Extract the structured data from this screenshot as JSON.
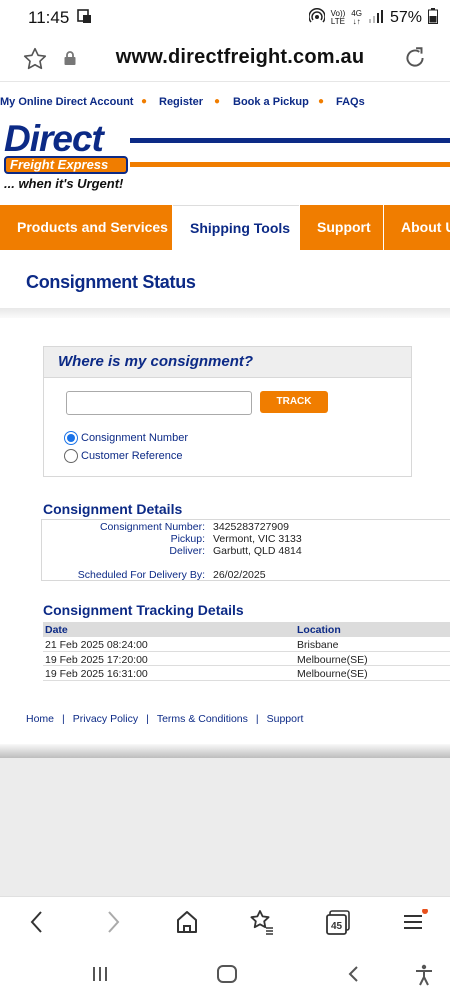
{
  "status_bar": {
    "time": "11:45",
    "volte_top": "Vo))",
    "volte_bottom": "LTE",
    "network": "4G",
    "battery": "57%"
  },
  "browser": {
    "url": "www.directfreight.com.au",
    "tab_count": "45"
  },
  "top_links": [
    "My Online Direct Account",
    "Register",
    "Book a Pickup",
    "FAQs"
  ],
  "logo": {
    "name": "Direct",
    "subtitle": "Freight Express",
    "tagline": "... when it's Urgent!"
  },
  "nav_tabs": [
    "Products and Services",
    "Shipping Tools",
    "Support",
    "About Us"
  ],
  "page_title": "Consignment Status",
  "tracker": {
    "heading": "Where is my consignment?",
    "input_value": "",
    "button_label": "TRACK",
    "options": [
      {
        "label": "Consignment Number",
        "selected": true
      },
      {
        "label": "Customer Reference",
        "selected": false
      }
    ]
  },
  "details": {
    "title": "Consignment Details",
    "rows": [
      {
        "label": "Consignment Number:",
        "value": "3425283727909"
      },
      {
        "label": "Pickup:",
        "value": "Vermont, VIC 3133"
      },
      {
        "label": "Deliver:",
        "value": "Garbutt, QLD 4814"
      },
      {
        "label": "Scheduled For Delivery By:",
        "value": "26/02/2025"
      }
    ]
  },
  "tracking": {
    "title": "Consignment Tracking Details",
    "columns": [
      "Date",
      "Location"
    ],
    "rows": [
      {
        "date": "21 Feb 2025 08:24:00",
        "location": "Brisbane"
      },
      {
        "date": "19 Feb 2025 17:20:00",
        "location": "Melbourne(SE)"
      },
      {
        "date": "19 Feb 2025 16:31:00",
        "location": "Melbourne(SE)"
      }
    ]
  },
  "footer_links": [
    "Home",
    "Privacy Policy",
    "Terms & Conditions",
    "Support"
  ],
  "colors": {
    "brand_blue": "#0c2a86",
    "brand_orange": "#f07d00"
  }
}
